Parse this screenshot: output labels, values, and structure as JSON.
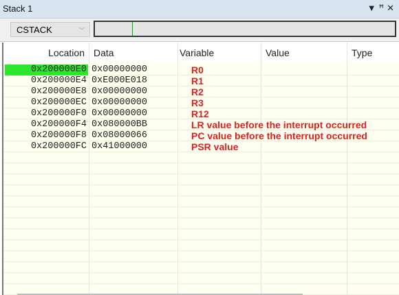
{
  "window": {
    "title": "Stack 1",
    "menu_icon": "dropdown-arrow",
    "pin_icon": "pin",
    "close_icon": "close"
  },
  "toolbar": {
    "stack_select": "CSTACK"
  },
  "table": {
    "columns": [
      "Location",
      "Data",
      "Variable",
      "Value",
      "Type"
    ],
    "rows": [
      {
        "location": "0x200000E0",
        "data": "0x00000000",
        "note": "R0"
      },
      {
        "location": "0x200000E4",
        "data": "0xE000E018",
        "note": "R1"
      },
      {
        "location": "0x200000E8",
        "data": "0x00000000",
        "note": "R2"
      },
      {
        "location": "0x200000EC",
        "data": "0x00000000",
        "note": "R3"
      },
      {
        "location": "0x200000F0",
        "data": "0x00000000",
        "note": "R12"
      },
      {
        "location": "0x200000F4",
        "data": "0x080000BB",
        "note": "LR value before the interrupt occurred"
      },
      {
        "location": "0x200000F8",
        "data": "0x08000066",
        "note": "PC value before the interrupt occurred"
      },
      {
        "location": "0x200000FC",
        "data": "0x41000000",
        "note": "PSR value"
      }
    ]
  }
}
